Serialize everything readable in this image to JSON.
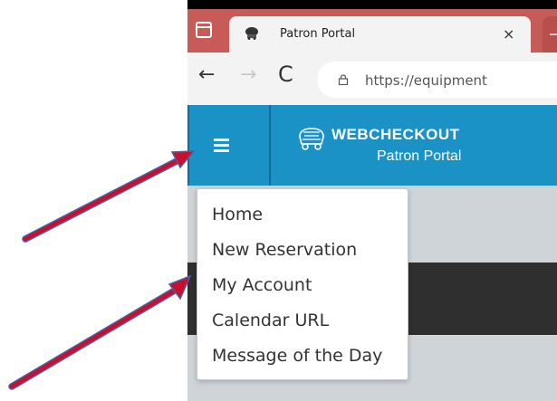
{
  "browser": {
    "tab_title": "Patron Portal",
    "tab_close": "×",
    "back_icon": "←",
    "forward_icon": "→",
    "reload_icon": "C",
    "url": "https://equipment"
  },
  "header": {
    "brand": "WEBCHECKOUT",
    "subtitle": "Patron Portal"
  },
  "menu": {
    "items": [
      {
        "label": "Home"
      },
      {
        "label": "New Reservation"
      },
      {
        "label": "My Account"
      },
      {
        "label": "Calendar URL"
      },
      {
        "label": "Message of the Day"
      }
    ]
  },
  "colors": {
    "tab_strip": "#c75b58",
    "header_blue": "#1b92c6",
    "arrow_red": "#c8102e",
    "arrow_outline": "#4a5fa5"
  },
  "icons": [
    "window-icon",
    "favicon-icon",
    "close-icon",
    "back-icon",
    "forward-icon",
    "reload-icon",
    "lock-icon",
    "hamburger-icon",
    "logo-icon",
    "arrow-annotation"
  ]
}
